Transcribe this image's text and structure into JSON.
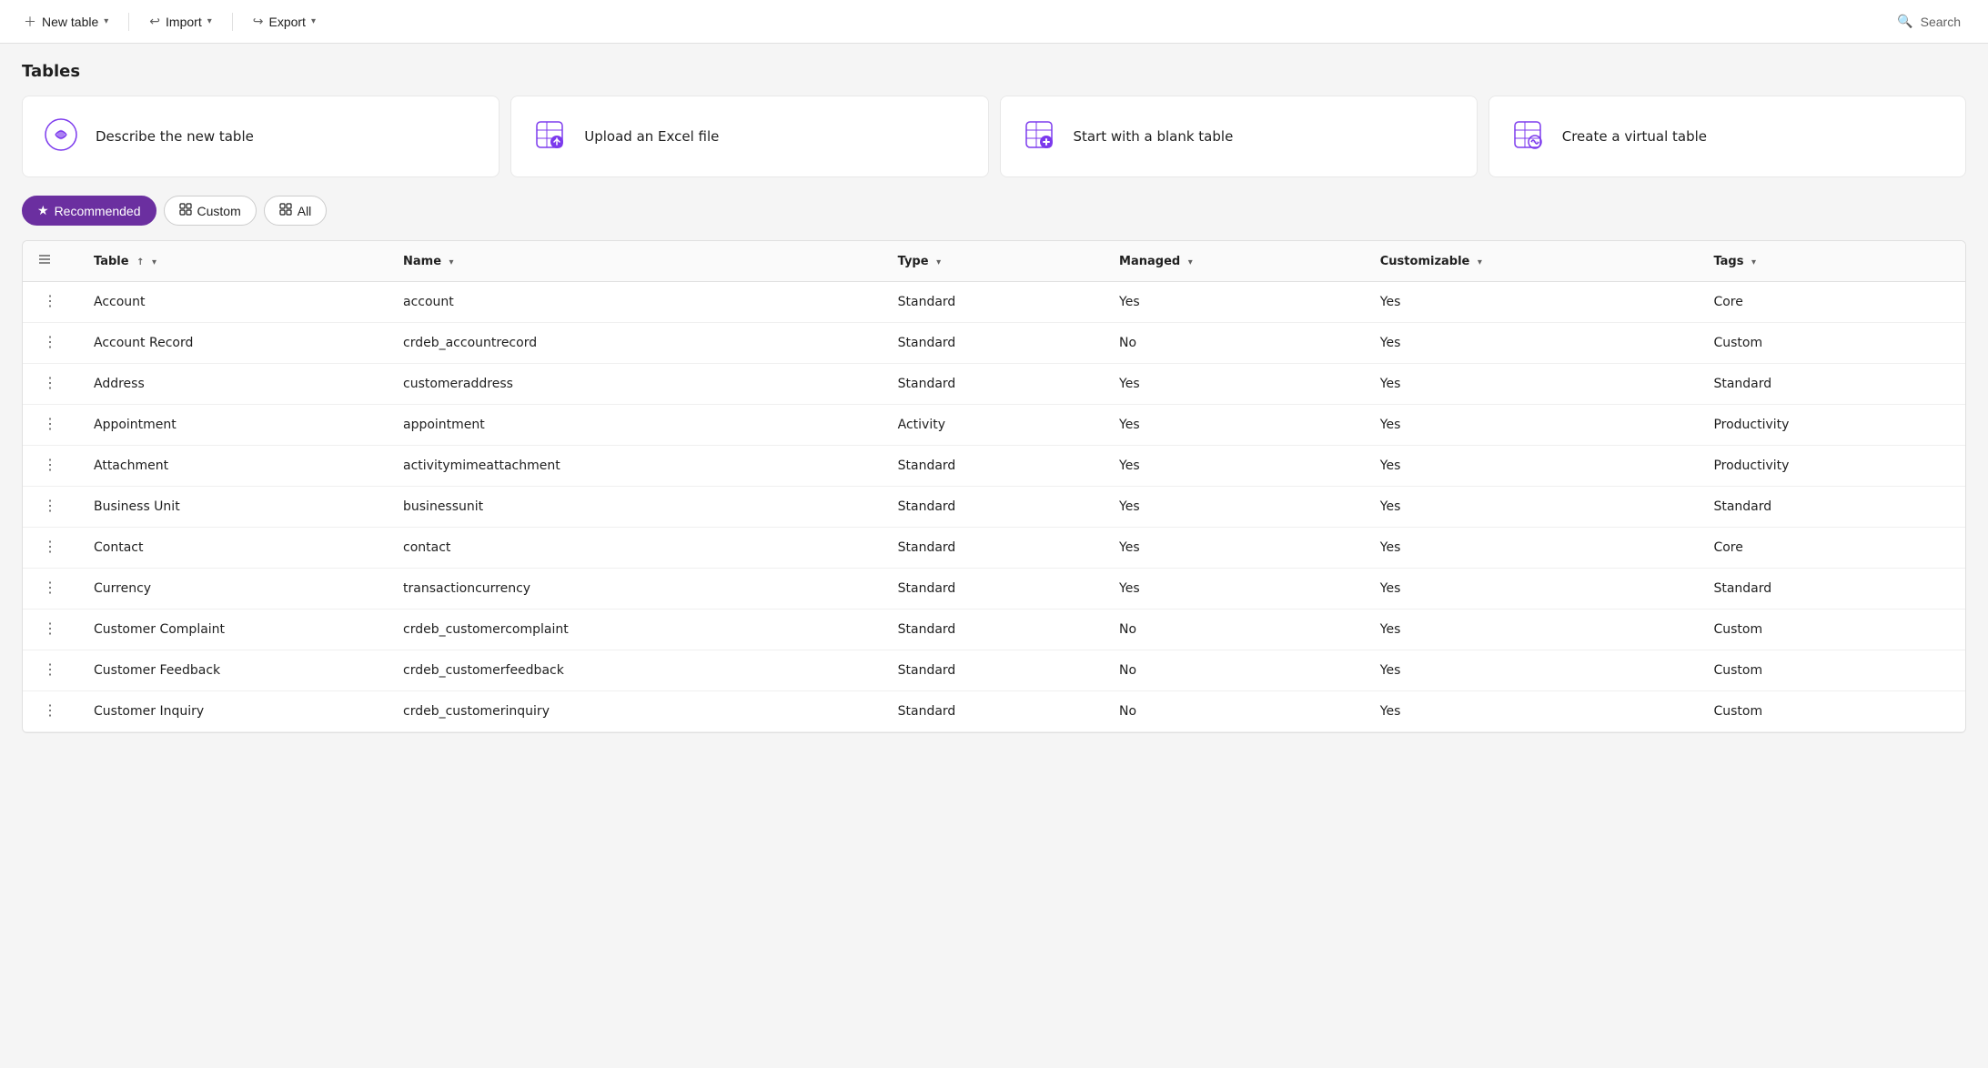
{
  "toolbar": {
    "new_table_label": "New table",
    "import_label": "Import",
    "export_label": "Export",
    "search_label": "Search"
  },
  "page": {
    "title": "Tables"
  },
  "cards": [
    {
      "id": "describe",
      "label": "Describe the new table",
      "icon": "ai-icon"
    },
    {
      "id": "upload",
      "label": "Upload an Excel file",
      "icon": "excel-icon"
    },
    {
      "id": "blank",
      "label": "Start with a blank table",
      "icon": "blank-table-icon"
    },
    {
      "id": "virtual",
      "label": "Create a virtual table",
      "icon": "virtual-table-icon"
    }
  ],
  "filters": [
    {
      "id": "recommended",
      "label": "Recommended",
      "active": true
    },
    {
      "id": "custom",
      "label": "Custom",
      "active": false
    },
    {
      "id": "all",
      "label": "All",
      "active": false
    }
  ],
  "table": {
    "columns": [
      {
        "id": "table",
        "label": "Table",
        "sortable": true,
        "sort": "asc"
      },
      {
        "id": "name",
        "label": "Name",
        "sortable": true
      },
      {
        "id": "type",
        "label": "Type",
        "sortable": true
      },
      {
        "id": "managed",
        "label": "Managed",
        "sortable": true
      },
      {
        "id": "customizable",
        "label": "Customizable",
        "sortable": true
      },
      {
        "id": "tags",
        "label": "Tags",
        "sortable": true
      }
    ],
    "rows": [
      {
        "table": "Account",
        "name": "account",
        "type": "Standard",
        "managed": "Yes",
        "customizable": "Yes",
        "tags": "Core"
      },
      {
        "table": "Account Record",
        "name": "crdeb_accountrecord",
        "type": "Standard",
        "managed": "No",
        "customizable": "Yes",
        "tags": "Custom"
      },
      {
        "table": "Address",
        "name": "customeraddress",
        "type": "Standard",
        "managed": "Yes",
        "customizable": "Yes",
        "tags": "Standard"
      },
      {
        "table": "Appointment",
        "name": "appointment",
        "type": "Activity",
        "managed": "Yes",
        "customizable": "Yes",
        "tags": "Productivity"
      },
      {
        "table": "Attachment",
        "name": "activitymimeattachment",
        "type": "Standard",
        "managed": "Yes",
        "customizable": "Yes",
        "tags": "Productivity"
      },
      {
        "table": "Business Unit",
        "name": "businessunit",
        "type": "Standard",
        "managed": "Yes",
        "customizable": "Yes",
        "tags": "Standard"
      },
      {
        "table": "Contact",
        "name": "contact",
        "type": "Standard",
        "managed": "Yes",
        "customizable": "Yes",
        "tags": "Core"
      },
      {
        "table": "Currency",
        "name": "transactioncurrency",
        "type": "Standard",
        "managed": "Yes",
        "customizable": "Yes",
        "tags": "Standard"
      },
      {
        "table": "Customer Complaint",
        "name": "crdeb_customercomplaint",
        "type": "Standard",
        "managed": "No",
        "customizable": "Yes",
        "tags": "Custom"
      },
      {
        "table": "Customer Feedback",
        "name": "crdeb_customerfeedback",
        "type": "Standard",
        "managed": "No",
        "customizable": "Yes",
        "tags": "Custom"
      },
      {
        "table": "Customer Inquiry",
        "name": "crdeb_customerinquiry",
        "type": "Standard",
        "managed": "No",
        "customizable": "Yes",
        "tags": "Custom"
      }
    ]
  },
  "colors": {
    "accent": "#6b2fa0",
    "icon_purple": "#7c3aed"
  }
}
